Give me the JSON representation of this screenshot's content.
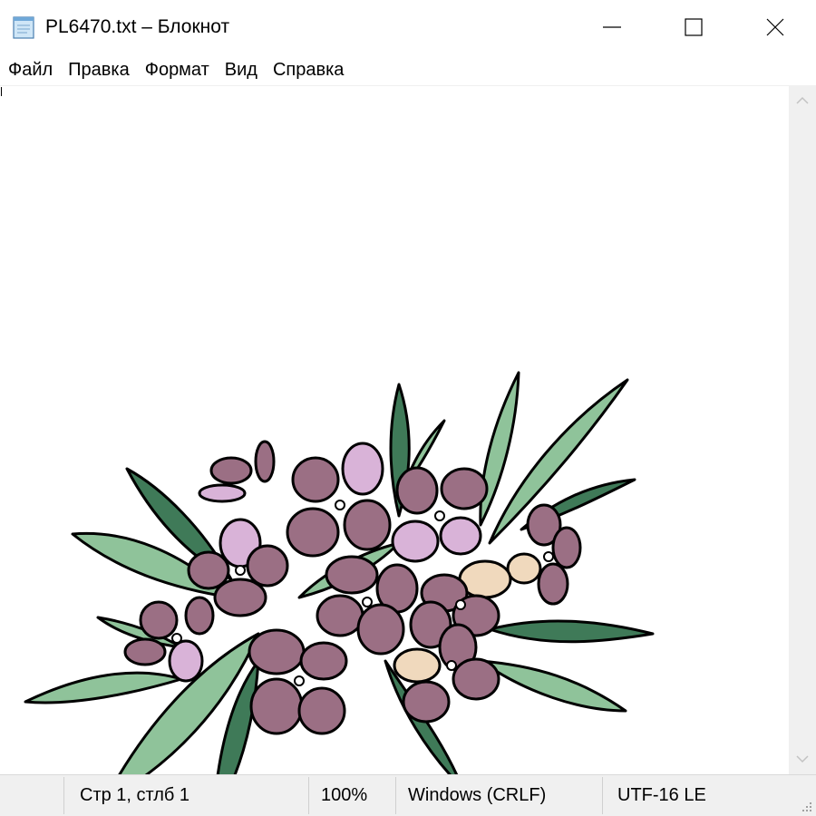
{
  "window": {
    "title": "PL6470.txt – Блокнот",
    "controls": {
      "minimize": "minimize-icon",
      "maximize": "maximize-icon",
      "close": "close-icon"
    }
  },
  "menu": [
    {
      "label": "Файл"
    },
    {
      "label": "Правка"
    },
    {
      "label": "Формат"
    },
    {
      "label": "Вид"
    },
    {
      "label": "Справка"
    }
  ],
  "editor": {
    "content": "ascii-art flower bouquet drawing",
    "colors": {
      "leaf": "#8fc39a",
      "leaf_dark": "#3f7a58",
      "petal": "#9b6f84",
      "petal_light": "#d9b3d8",
      "petal_cream": "#f0d9bd",
      "outline": "#000000"
    }
  },
  "status": {
    "position": "Стр 1, стлб 1",
    "zoom": "100%",
    "line_endings": "Windows (CRLF)",
    "encoding": "UTF-16 LE"
  }
}
